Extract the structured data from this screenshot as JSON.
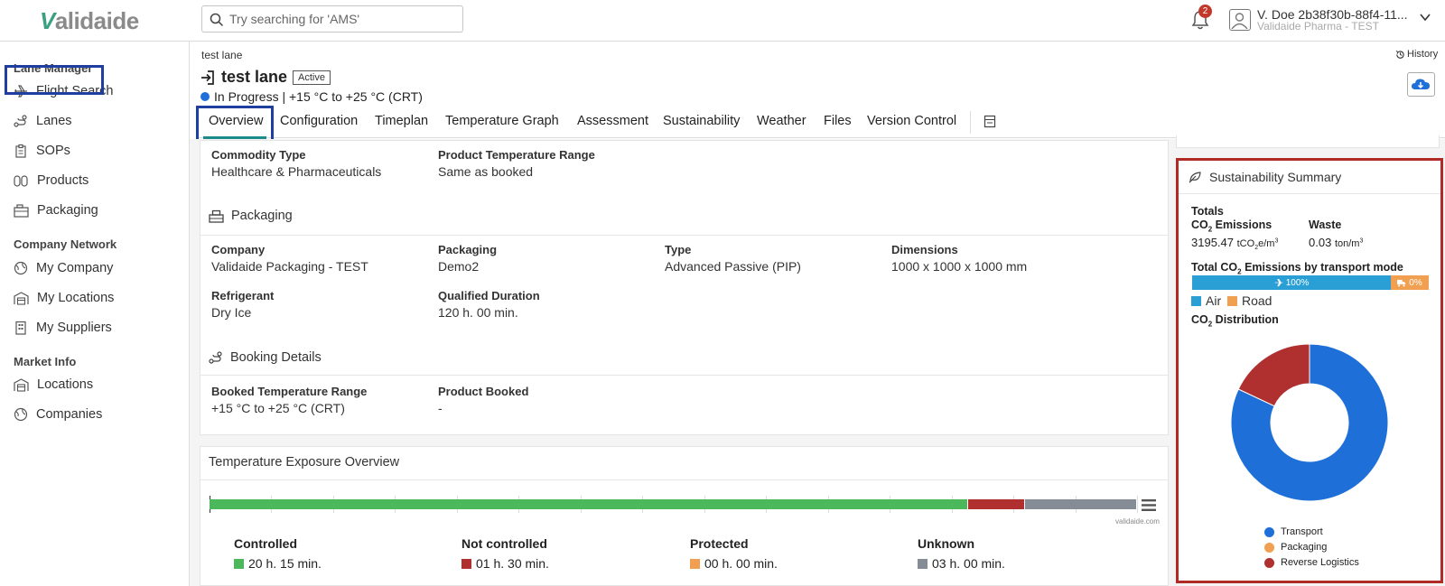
{
  "header": {
    "logo_v": "V",
    "logo_rest": "alidaide",
    "search_placeholder": "Try searching for 'AMS'",
    "notification_count": "2",
    "user_name": "V. Doe 2b38f30b-88f4-11...",
    "user_org": "Validaide Pharma - TEST"
  },
  "sidebar": {
    "sections": [
      {
        "title": "Lane Manager",
        "items": [
          "Flight Search",
          "Lanes",
          "SOPs",
          "Products",
          "Packaging"
        ]
      },
      {
        "title": "Company Network",
        "items": [
          "My Company",
          "My Locations",
          "My Suppliers"
        ]
      },
      {
        "title": "Market Info",
        "items": [
          "Locations",
          "Companies"
        ]
      }
    ]
  },
  "page": {
    "breadcrumb": "test lane",
    "history_label": "History",
    "title": "test lane",
    "status_badge": "Active",
    "progress_status": "In Progress | +15 °C to +25 °C (CRT)"
  },
  "tabs": [
    "Overview",
    "Configuration",
    "Timeplan",
    "Temperature Graph",
    "Assessment",
    "Sustainability",
    "Weather",
    "Files",
    "Version Control"
  ],
  "commodity": {
    "commodity_type_label": "Commodity Type",
    "commodity_type_value": "Healthcare & Pharmaceuticals",
    "product_temp_label": "Product Temperature Range",
    "product_temp_value": "Same as booked"
  },
  "packaging": {
    "heading": "Packaging",
    "company_label": "Company",
    "company_value": "Validaide Packaging - TEST",
    "packaging_label": "Packaging",
    "packaging_value": "Demo2",
    "type_label": "Type",
    "type_value": "Advanced Passive (PIP)",
    "dimensions_label": "Dimensions",
    "dimensions_value": "1000 x 1000 x 1000 mm",
    "refrigerant_label": "Refrigerant",
    "refrigerant_value": "Dry Ice",
    "qualified_label": "Qualified Duration",
    "qualified_value": "120 h. 00 min."
  },
  "booking": {
    "heading": "Booking Details",
    "booked_temp_label": "Booked Temperature Range",
    "booked_temp_value": "+15 °C to +25 °C (CRT)",
    "product_booked_label": "Product Booked",
    "product_booked_value": "-"
  },
  "temperature_exposure": {
    "heading": "Temperature Exposure Overview",
    "credit": "validaide.com",
    "categories": [
      {
        "label": "Controlled",
        "value": "20 h. 15 min.",
        "color": "#4cb85c",
        "minutes": 1215
      },
      {
        "label": "Not controlled",
        "value": "01 h. 30 min.",
        "color": "#b03030",
        "minutes": 90
      },
      {
        "label": "Protected",
        "value": "00 h. 00 min.",
        "color": "#f0a050",
        "minutes": 0
      },
      {
        "label": "Unknown",
        "value": "03 h. 00 min.",
        "color": "#858c96",
        "minutes": 180
      }
    ]
  },
  "sustainability": {
    "heading": "Sustainability Summary",
    "totals_label": "Totals",
    "co2_label": "CO",
    "co2_label_sub": "2",
    "co2_label_rest": " Emissions",
    "co2_value": "3195.47",
    "co2_unit": "tCO",
    "co2_unit_sub": "2",
    "co2_unit_rest": "e/m",
    "co2_unit_sup": "3",
    "waste_label": "Waste",
    "waste_value": "0.03",
    "waste_unit": "ton/m",
    "waste_unit_sup": "3",
    "mode_title_a": "Total CO",
    "mode_title_sub": "2",
    "mode_title_b": " Emissions by transport mode",
    "modes": [
      {
        "name": "Air",
        "percent_label": "100%",
        "share": 100,
        "color": "#2a9fd6"
      },
      {
        "name": "Road",
        "percent_label": "0%",
        "share": 0,
        "color": "#f0a050"
      }
    ],
    "dist_title_a": "CO",
    "dist_title_sub": "2",
    "dist_title_b": " Distribution"
  },
  "chart_data": {
    "type": "pie",
    "categories": [
      "Transport",
      "Packaging",
      "Reverse Logistics"
    ],
    "values": [
      82,
      0,
      18
    ],
    "colors": [
      "#1f6fd8",
      "#f0a050",
      "#b03030"
    ]
  }
}
